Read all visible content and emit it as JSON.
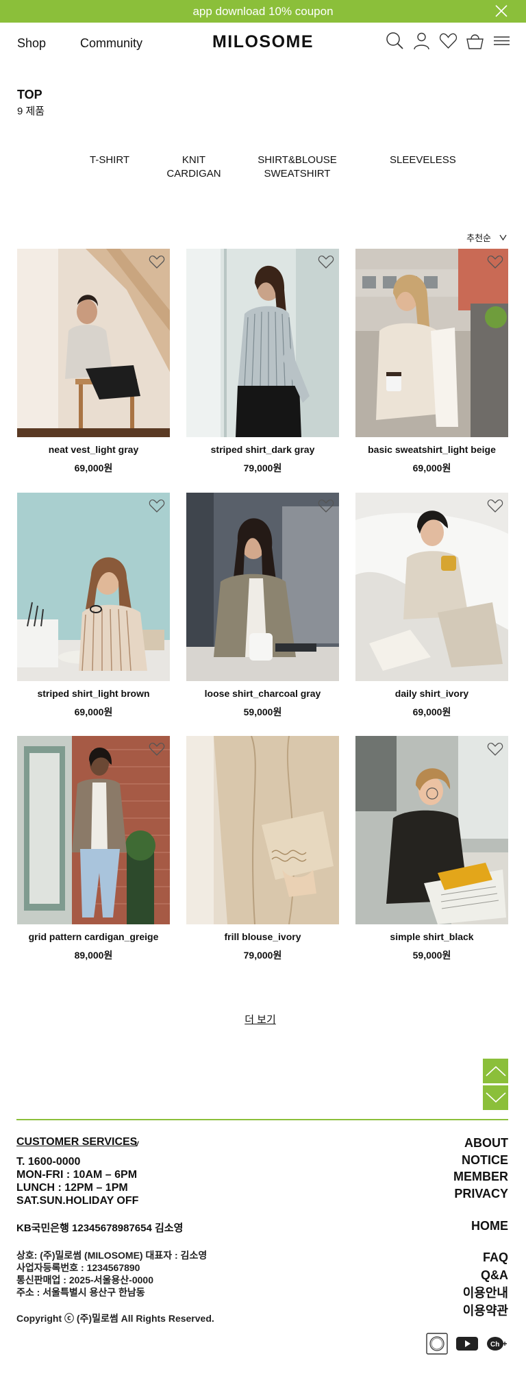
{
  "topbar": {
    "text": "app download 10% coupon",
    "close_icon": "close-icon"
  },
  "header": {
    "nav": {
      "shop": "Shop",
      "community": "Community"
    },
    "logo": "MILOSOME",
    "icons": [
      "search-icon",
      "user-icon",
      "heart-icon",
      "cart-icon",
      "menu-icon"
    ]
  },
  "category": {
    "title": "TOP",
    "count": "9 제품"
  },
  "subcategories": {
    "tshirt": "T-SHIRT",
    "knit_1": "KNIT",
    "knit_2": "CARDIGAN",
    "shirt_1": "SHIRT&BLOUSE",
    "shirt_2": "SWEATSHIRT",
    "sleeveless": "SLEEVELESS"
  },
  "sort": {
    "label": "추천순",
    "icon": "chevron-down-icon"
  },
  "products": [
    {
      "name": "neat vest_light gray",
      "price": "69,000원"
    },
    {
      "name": "striped shirt_dark gray",
      "price": "79,000원"
    },
    {
      "name": "basic sweatshirt_light beige",
      "price": "69,000원"
    },
    {
      "name": "striped shirt_light brown",
      "price": "69,000원"
    },
    {
      "name": "loose shirt_charcoal gray",
      "price": "59,000원"
    },
    {
      "name": "daily shirt_ivory",
      "price": "69,000원"
    },
    {
      "name": "grid pattern cardigan_greige",
      "price": "89,000원"
    },
    {
      "name": "frill  blouse_ivory",
      "price": "79,000원"
    },
    {
      "name": "simple shirt_black",
      "price": "59,000원"
    }
  ],
  "more": "더 보기",
  "footer": {
    "cs_title": "CUSTOMER SERVICES",
    "cs_chevron": "v",
    "phone": "T. 1600-0000",
    "hours": "MON-FRI : 10AM – 6PM",
    "lunch": "LUNCH : 12PM – 1PM",
    "weekend": "SAT.SUN.HOLIDAY OFF",
    "bank": "KB국민은행 12345678987654 김소영",
    "company": "상호: (주)밀로썸 (MILOSOME)  대표자 : 김소영",
    "reg": "사업자등록번호 : 1234567890",
    "mail_order": "통신판매업 : 2025-서울용산-0000",
    "address": "주소 : 서울특별시 용산구 한남동",
    "copyright": "Copyright ⓒ (주)밀로썸 All Rights Reserved.",
    "links1": {
      "about": "ABOUT",
      "notice": "NOTICE",
      "member": "MEMBER",
      "privacy": "PRIVACY"
    },
    "links2": {
      "home": "HOME"
    },
    "links3": {
      "faq": "FAQ",
      "qa": "Q&A",
      "guide": "이용안내",
      "terms": "이용약관"
    },
    "social_icons": [
      "instagram-icon",
      "youtube-icon",
      "kakao-channel-icon"
    ]
  },
  "colors": {
    "accent": "#8bbf3a",
    "text": "#111111"
  }
}
